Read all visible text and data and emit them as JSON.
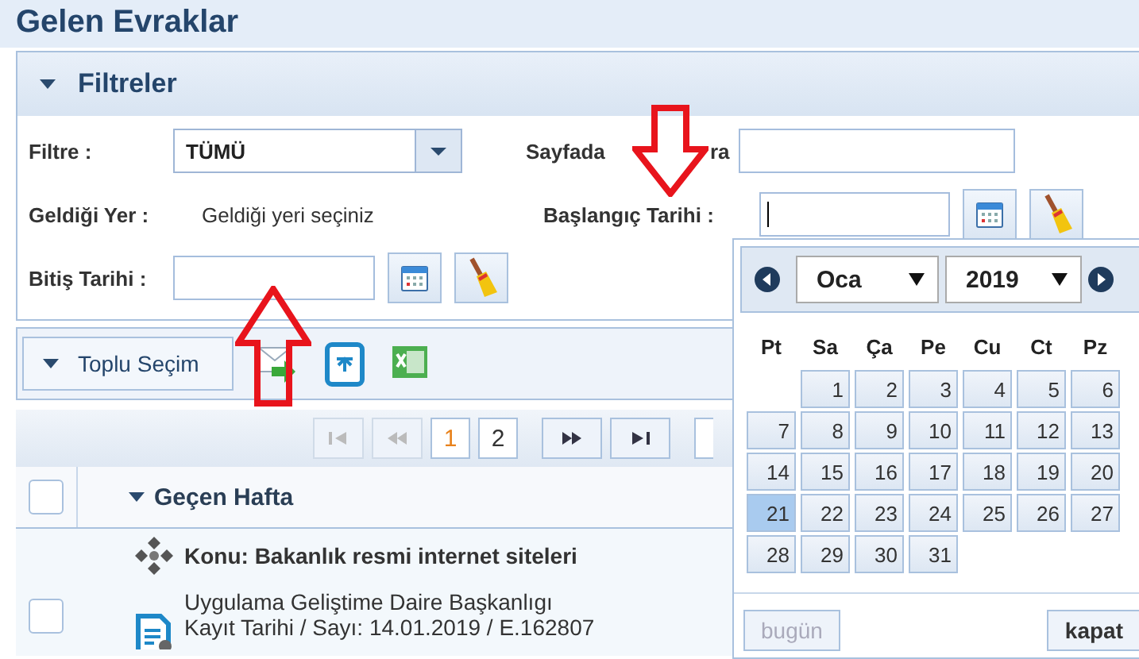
{
  "title": "Gelen Evraklar",
  "filters": {
    "title": "Filtreler",
    "expanded": true,
    "filter": {
      "label": "Filtre :",
      "value": "TÜMÜ"
    },
    "page_order": {
      "label_parts": [
        "Sayfada",
        "ra"
      ]
    },
    "source": {
      "label": "Geldiği Yer :",
      "placeholder": "Geldiği yeri seçiniz"
    },
    "start_date": {
      "label": "Başlangıç Tarihi :",
      "focused": true
    },
    "end_date": {
      "label": "Bitiş Tarihi :"
    }
  },
  "toolbar": {
    "bulk_select": "Toplu Seçim"
  },
  "pager": [
    {
      "kind": "first",
      "disabled": true
    },
    {
      "kind": "prev",
      "disabled": true
    },
    {
      "kind": "page",
      "label": "1",
      "selected": true
    },
    {
      "kind": "page",
      "label": "2",
      "selected": false
    },
    {
      "kind": "next",
      "disabled": false
    },
    {
      "kind": "last",
      "disabled": false
    }
  ],
  "group": {
    "label": "Geçen Hafta",
    "expanded": true,
    "checked": false
  },
  "rows": [
    {
      "kind": "subject",
      "text": "Konu: Bakanlık resmi internet siteleri"
    },
    {
      "kind": "document",
      "checked": false,
      "lines": [
        "Uygulama Geliştime Daire Başkanlıgı",
        "Kayıt Tarihi / Sayı: 14.01.2019 / E.162807"
      ]
    }
  ],
  "calendar": {
    "month": "Oca",
    "year": "2019",
    "weekdays": [
      "Pt",
      "Sa",
      "Ça",
      "Pe",
      "Cu",
      "Ct",
      "Pz"
    ],
    "weeks": [
      {
        "days": [
          {
            "day": "1",
            "selected": false
          },
          {
            "day": "2",
            "selected": false
          },
          {
            "day": "3",
            "selected": false
          },
          {
            "day": "4",
            "selected": false
          },
          {
            "day": "5",
            "selected": false
          },
          {
            "day": "6",
            "selected": false
          }
        ]
      },
      {
        "days": [
          {
            "day": "7",
            "selected": false
          },
          {
            "day": "8",
            "selected": false
          },
          {
            "day": "9",
            "selected": false
          },
          {
            "day": "10",
            "selected": false
          },
          {
            "day": "11",
            "selected": false
          },
          {
            "day": "12",
            "selected": false
          },
          {
            "day": "13",
            "selected": false
          }
        ]
      },
      {
        "days": [
          {
            "day": "14",
            "selected": false
          },
          {
            "day": "15",
            "selected": false
          },
          {
            "day": "16",
            "selected": false
          },
          {
            "day": "17",
            "selected": false
          },
          {
            "day": "18",
            "selected": false
          },
          {
            "day": "19",
            "selected": false
          },
          {
            "day": "20",
            "selected": false
          }
        ]
      },
      {
        "days": [
          {
            "day": "21",
            "selected": true
          },
          {
            "day": "22",
            "selected": false
          },
          {
            "day": "23",
            "selected": false
          },
          {
            "day": "24",
            "selected": false
          },
          {
            "day": "25",
            "selected": false
          },
          {
            "day": "26",
            "selected": false
          },
          {
            "day": "27",
            "selected": false
          }
        ]
      },
      {
        "days": [
          {
            "day": "28",
            "selected": false
          },
          {
            "day": "29",
            "selected": false
          },
          {
            "day": "30",
            "selected": false
          },
          {
            "day": "31",
            "selected": false
          }
        ]
      }
    ],
    "today": {
      "label": "bugün",
      "disabled": true
    },
    "close": "kapat"
  },
  "annotations": [
    {
      "kind": "down-arrow"
    },
    {
      "kind": "up-arrow"
    }
  ]
}
